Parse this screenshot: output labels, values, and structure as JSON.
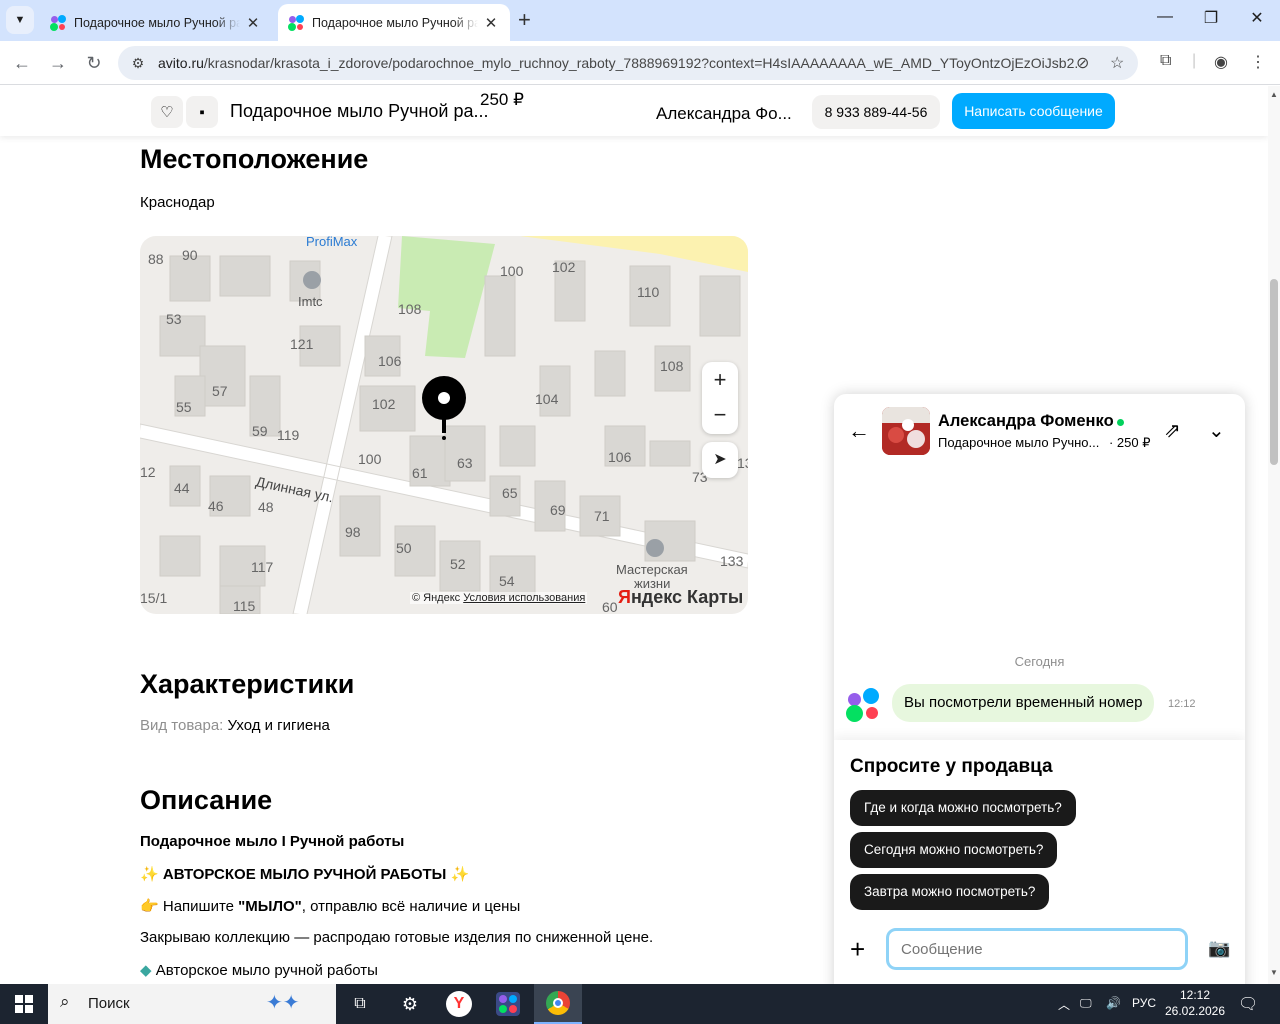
{
  "browser": {
    "tabs": [
      {
        "title": "Подарочное мыло Ручной раб",
        "active": false
      },
      {
        "title": "Подарочное мыло Ручной раб",
        "active": true
      }
    ],
    "url_host": "avito.ru",
    "url_path": "/krasnodar/krasota_i_zdorove/podarochnoe_mylo_ruchnoy_raboty_7888969192?context=H4sIAAAAAAAA_wE_AMD_YToyOntzOjEzOiJsb2..."
  },
  "sticky_header": {
    "title": "Подарочное мыло Ручной ра...",
    "price": "250 ₽",
    "seller": "Александра Фо...",
    "phone": "8 933 889-44-56",
    "message_button": "Написать сообщение"
  },
  "location": {
    "heading": "Местоположение",
    "city": "Краснодар"
  },
  "map": {
    "street_label": "Длинная ул.",
    "poi_top": "ProfiMax",
    "poi_imtc": "Imtc",
    "poi_master_1": "Мастерская",
    "poi_master_2": "жизни",
    "house_numbers": [
      "88",
      "90",
      "53",
      "121",
      "108",
      "100",
      "102",
      "110",
      "106",
      "108",
      "57",
      "55",
      "102",
      "104",
      "59",
      "119",
      "100",
      "61",
      "63",
      "106",
      "73",
      "44",
      "46",
      "48",
      "65",
      "69",
      "71",
      "98",
      "50",
      "52",
      "54",
      "117",
      "133",
      "115",
      "15/1",
      "60",
      "13",
      "12"
    ],
    "copyright_prefix": "© Яндекс",
    "terms_link": "Условия использования",
    "brand_y": "Я",
    "brand_rest": "ндекс Карты",
    "zoom_in": "+",
    "zoom_out": "−"
  },
  "characteristics": {
    "heading": "Характеристики",
    "label": "Вид товара:",
    "value": "Уход и гигиена"
  },
  "description": {
    "heading": "Описание",
    "line1": "Подарочное мыло I Ручной работы",
    "line2": "АВТОРСКОЕ МЫЛО РУЧНОЙ РАБОТЫ",
    "line3_pre": "Напишите",
    "line3_bold": "\"МЫЛО\"",
    "line3_post": ", отправлю всё наличие и цены",
    "line4": "Закрываю коллекцию — распродаю готовые изделия по сниженной цене.",
    "line5": "Авторское мыло ручной работы"
  },
  "chat": {
    "name": "Александра Фоменко",
    "item": "Подарочное мыло Ручно...",
    "price": "· 250 ₽",
    "date_separator": "Сегодня",
    "message": "Вы посмотрели временный номер",
    "message_time": "12:12",
    "ask_heading": "Спросите у продавца",
    "quick_replies": [
      "Где и когда можно посмотреть?",
      "Сегодня можно посмотреть?",
      "Завтра можно посмотреть?"
    ],
    "input_placeholder": "Сообщение"
  },
  "taskbar": {
    "search_label": "Поиск",
    "lang": "РУС",
    "time": "12:12",
    "date": "26.02.2026"
  },
  "colors": {
    "accent_blue": "#00aaff",
    "online_green": "#02d15c",
    "bubble_green": "#e7f7de"
  }
}
